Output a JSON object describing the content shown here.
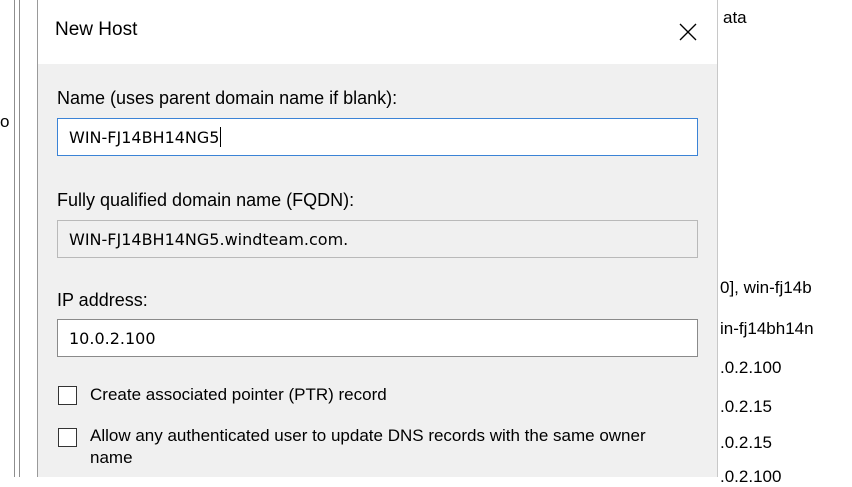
{
  "background": {
    "left_fragment": "o",
    "right_fragments": [
      "ata",
      "0], win-fj14b",
      "in-fj14bh14n",
      ".0.2.100",
      ".0.2.15",
      ".0.2.15",
      ".0.2.100"
    ]
  },
  "dialog": {
    "title": "New Host",
    "close_icon": "close-icon",
    "name_label": "Name (uses parent domain name if blank):",
    "name_value": "WIN-FJ14BH14NG5",
    "fqdn_label": "Fully qualified domain name (FQDN):",
    "fqdn_value": "WIN-FJ14BH14NG5.windteam.com.",
    "ip_label": "IP address:",
    "ip_value": "10.0.2.100",
    "ptr_checkbox_label": "Create associated pointer (PTR) record",
    "allow_update_label": "Allow any authenticated user to update DNS records with the same owner name"
  },
  "colors": {
    "dialog_bg": "#f0f0f0",
    "focus_border": "#3b83d6"
  }
}
